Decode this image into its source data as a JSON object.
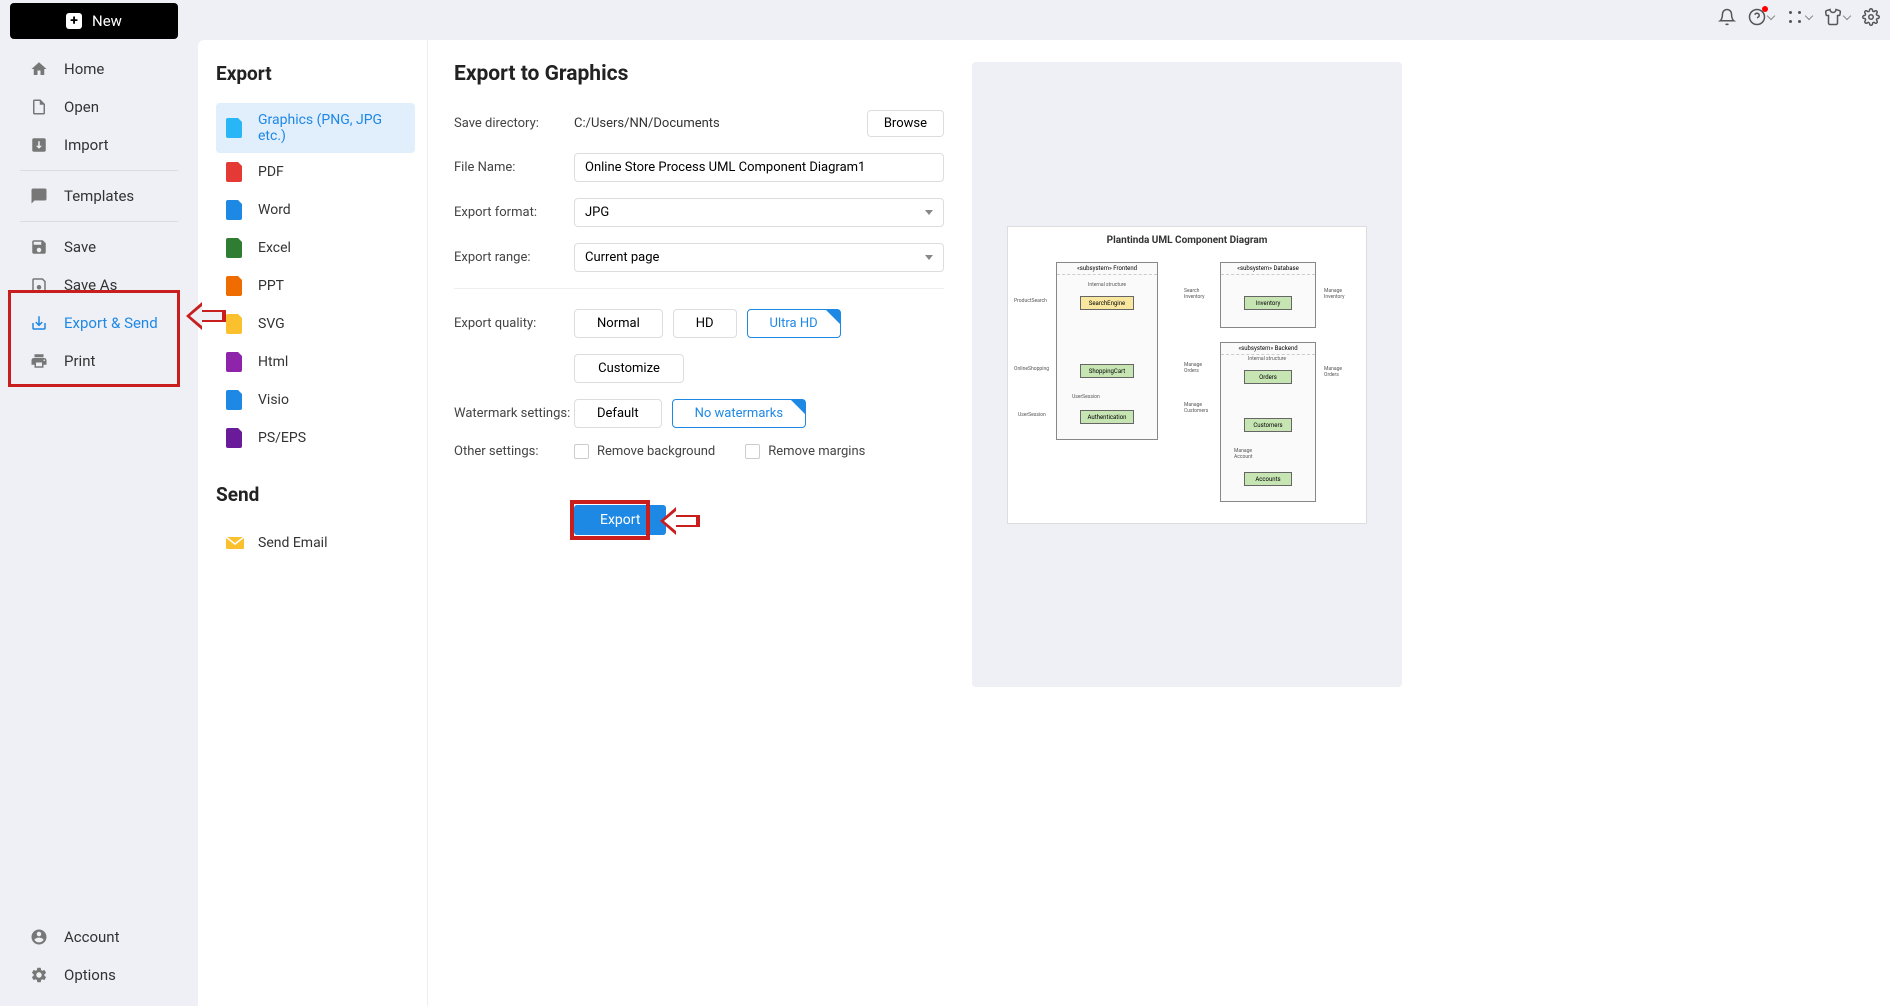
{
  "new_button": "New",
  "topbar": {},
  "sidebar": {
    "items": [
      {
        "label": "Home"
      },
      {
        "label": "Open"
      },
      {
        "label": "Import"
      },
      {
        "label": "Templates"
      },
      {
        "label": "Save"
      },
      {
        "label": "Save As"
      },
      {
        "label": "Export & Send"
      },
      {
        "label": "Print"
      }
    ],
    "bottom": [
      {
        "label": "Account"
      },
      {
        "label": "Options"
      }
    ]
  },
  "export_section": {
    "title": "Export",
    "items": [
      {
        "label": "Graphics (PNG, JPG etc.)",
        "color": "#29b6f6"
      },
      {
        "label": "PDF",
        "color": "#e53935"
      },
      {
        "label": "Word",
        "color": "#1e88e5"
      },
      {
        "label": "Excel",
        "color": "#2e7d32"
      },
      {
        "label": "PPT",
        "color": "#ef6c00"
      },
      {
        "label": "SVG",
        "color": "#fbc02d"
      },
      {
        "label": "Html",
        "color": "#8e24aa"
      },
      {
        "label": "Visio",
        "color": "#1e88e5"
      },
      {
        "label": "PS/EPS",
        "color": "#6a1b9a"
      }
    ]
  },
  "send_section": {
    "title": "Send",
    "items": [
      {
        "label": "Send Email"
      }
    ]
  },
  "form": {
    "title": "Export to Graphics",
    "save_dir_label": "Save directory:",
    "save_dir_value": "C:/Users/NN/Documents",
    "browse_label": "Browse",
    "file_name_label": "File Name:",
    "file_name_value": "Online Store Process UML Component Diagram1",
    "format_label": "Export format:",
    "format_value": "JPG",
    "range_label": "Export range:",
    "range_value": "Current page",
    "quality_label": "Export quality:",
    "quality_options": [
      "Normal",
      "HD",
      "Ultra HD"
    ],
    "customize_label": "Customize",
    "watermark_label": "Watermark settings:",
    "watermark_options": [
      "Default",
      "No watermarks"
    ],
    "other_label": "Other settings:",
    "remove_bg": "Remove background",
    "remove_margins": "Remove margins",
    "export_btn": "Export"
  },
  "preview": {
    "title": "Plantinda UML Component Diagram",
    "subsystems": [
      {
        "label": "«subsystem» Frontend"
      },
      {
        "label": "«subsystem» Database"
      },
      {
        "label": "«subsystem» Backend"
      }
    ],
    "components": [
      "SearchEngine",
      "ShoppingCart",
      "Authentication",
      "Inventory",
      "Orders",
      "Customers",
      "Accounts"
    ],
    "ports": [
      "ProductSearch",
      "OnlineShopping",
      "UserSession",
      "Search Inventory",
      "Manage Inventory",
      "Manage Orders",
      "Manage Customers",
      "Manage Account",
      "UserSession",
      "Internal structure",
      "Internal structure"
    ]
  }
}
